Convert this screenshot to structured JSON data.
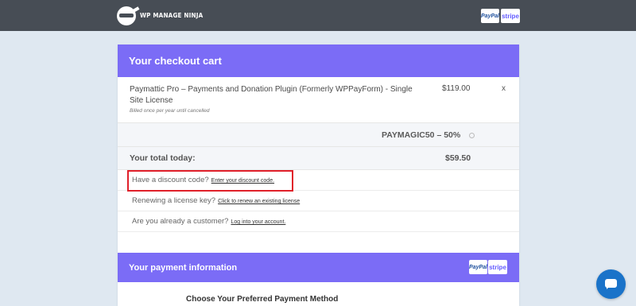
{
  "topbar": {
    "brand": "WP MANAGE NINJA",
    "logo_icon": "ninja-logo-icon",
    "payment_badges": [
      "PayPal",
      "stripe"
    ]
  },
  "cart": {
    "title": "Your checkout cart",
    "product": {
      "name": "Paymattic Pro – Payments and Donation Plugin (Formerly WPPayForm) - Single Site License",
      "note": "Billed once per year until cancelled",
      "price": "$119.00",
      "remove_icon": "x"
    },
    "coupon": {
      "text": "PAYMAGIC50 – 50%",
      "remove_icon": "remove-coupon-icon"
    },
    "total": {
      "label": "Your total today:",
      "amount": "$59.50"
    },
    "links": [
      {
        "question": "Have a discount code?",
        "action": "Enter your discount code."
      },
      {
        "question": "Renewing a license key?",
        "action": "Click to renew an existing license"
      },
      {
        "question": "Are you already a customer?",
        "action": "Log into your account."
      }
    ]
  },
  "payment": {
    "title": "Your payment information",
    "badges": [
      "PayPal",
      "stripe"
    ],
    "choose_label": "Choose Your Preferred Payment Method"
  },
  "chat": {
    "icon": "chat-icon"
  },
  "colors": {
    "topbar": "#474d55",
    "accent": "#7b6cf6",
    "highlight": "#e0202a",
    "chat": "#1a73c9"
  }
}
